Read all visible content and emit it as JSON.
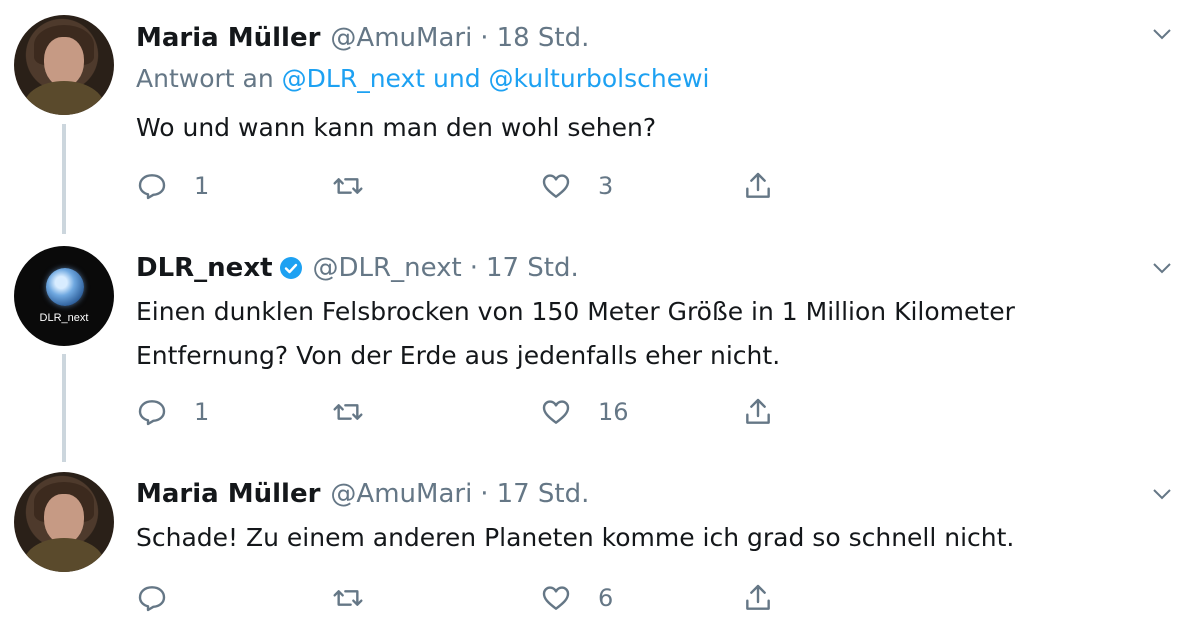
{
  "tweets": [
    {
      "name": "Maria Müller",
      "handle": "@AmuMari",
      "separator": "·",
      "time": "18 Std.",
      "reply_prefix": "Antwort an",
      "reply_user1": "@DLR_next",
      "reply_and": "und",
      "reply_user2": "@kulturbolschewi",
      "text": "Wo und wann kann man den wohl sehen?",
      "replies": "1",
      "retweets": "",
      "likes": "3",
      "avatar_icon": "avatar-photo"
    },
    {
      "name": "DLR_next",
      "verified": true,
      "handle": "@DLR_next",
      "separator": "·",
      "time": "17 Std.",
      "text_line1": "Einen dunklen Felsbrocken von 150 Meter Größe in 1 Million Kilometer",
      "text_line2": "Entfernung? Von der Erde aus jedenfalls eher nicht.",
      "avatar_label": "DLR_next",
      "replies": "1",
      "retweets": "",
      "likes": "16"
    },
    {
      "name": "Maria Müller",
      "handle": "@AmuMari",
      "separator": "·",
      "time": "17 Std.",
      "text": "Schade! Zu einem anderen Planeten komme ich grad so schnell nicht.",
      "replies": "",
      "retweets": "",
      "likes": "6",
      "avatar_icon": "avatar-photo"
    }
  ],
  "icons": {
    "reply": "reply-icon",
    "retweet": "retweet-icon",
    "like": "heart-icon",
    "share": "share-icon",
    "more": "chevron-down-icon",
    "verified": "verified-badge-icon"
  },
  "colors": {
    "link": "#1da1f2",
    "muted": "#657786",
    "text": "#14171a",
    "thread_line": "#ccd6dd"
  }
}
